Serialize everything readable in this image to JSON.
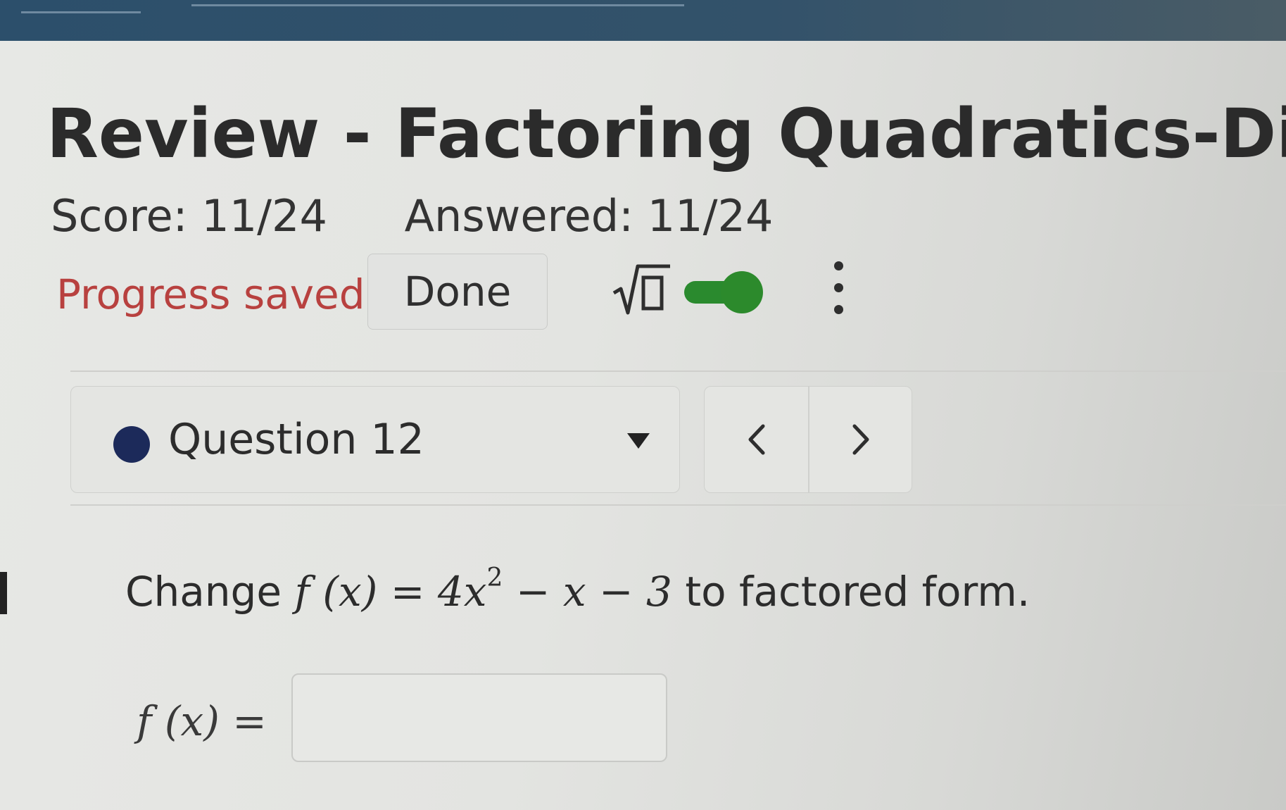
{
  "assignment": {
    "title": "Review - Factoring Quadratics-Diamon",
    "score_text": "Score: 11/24",
    "answered_text": "Answered: 11/24"
  },
  "toolbar": {
    "progress_text": "Progress saved",
    "done_label": "Done",
    "math_icon": "sqrt-icon",
    "toggle_on": true,
    "toggle_color": "#2c8a2c",
    "menu_icon": "kebab-icon"
  },
  "question_nav": {
    "current": "Question 12",
    "status_color": "#1c2a5a",
    "prev_icon": "chevron-left-icon",
    "next_icon": "chevron-right-icon"
  },
  "question": {
    "prompt_prefix": "Change",
    "function_lhs": "f (x)",
    "equals": "=",
    "expr_coef": "4x",
    "expr_exp": "2",
    "expr_rest": "− x − 3",
    "prompt_suffix": "to factored form.",
    "answer_label": "f (x) =",
    "answer_value": ""
  }
}
